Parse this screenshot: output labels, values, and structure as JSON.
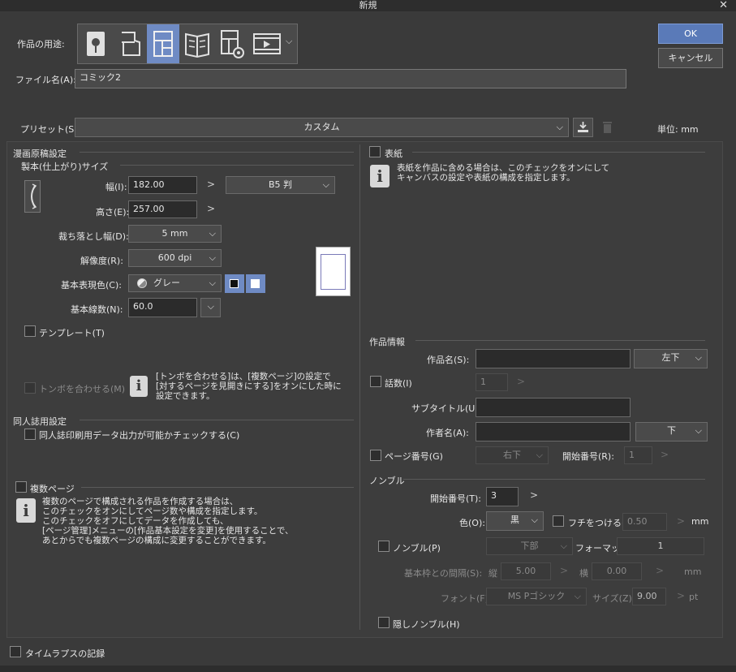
{
  "window": {
    "title": "新規",
    "close": "✕"
  },
  "purpose": {
    "label": "作品の用途:",
    "icons": [
      "illustration-icon",
      "webtoon-icon",
      "comic-icon",
      "book-icon",
      "page-settings-icon",
      "animation-icon"
    ],
    "active_index": 2
  },
  "actions": {
    "ok": "OK",
    "cancel": "キャンセル"
  },
  "filename": {
    "label": "ファイル名(A):",
    "value": "コミック2"
  },
  "preset": {
    "label": "プリセット(S):",
    "value": "カスタム",
    "unit": "単位: mm"
  },
  "manga": {
    "section": "漫画原稿設定",
    "subsection": "製本(仕上がり)サイズ",
    "width": {
      "label": "幅(I):",
      "value": "182.00",
      "size": "B5 判"
    },
    "height": {
      "label": "高さ(E):",
      "value": "257.00"
    },
    "bleed": {
      "label": "裁ち落とし幅(D):",
      "value": "5 mm"
    },
    "resolution": {
      "label": "解像度(R):",
      "value": "600 dpi"
    },
    "color": {
      "label": "基本表現色(C):",
      "value": "グレー"
    },
    "lines": {
      "label": "基本線数(N):",
      "value": "60.0"
    },
    "template": "テンプレート(T)",
    "tombo": "トンボを合わせる(M)",
    "tombo_note": [
      "[トンボを合わせる]は、[複数ページ]の設定で",
      "[対するページを見開きにする]をオンにした時に",
      "設定できます。"
    ]
  },
  "doujin": {
    "section": "同人誌用設定",
    "check": "同人誌印刷用データ出力が可能かチェックする(C)"
  },
  "multi": {
    "check": "複数ページ",
    "note": [
      "複数のページで構成される作品を作成する場合は、",
      "このチェックをオンにしてページ数や構成を指定します。",
      "このチェックをオフにしてデータを作成しても、",
      "[ページ管理]メニューの[作品基本設定を変更]を使用することで、",
      "あとからでも複数ページの構成に変更することができます。"
    ]
  },
  "cover": {
    "check": "表紙",
    "note": [
      "表紙を作品に含める場合は、このチェックをオンにして",
      "キャンバスの設定や表紙の構成を指定します。"
    ]
  },
  "info": {
    "section": "作品情報",
    "title": {
      "label": "作品名(S):",
      "value": "",
      "pos": "左下"
    },
    "episode": {
      "label": "話数(I)",
      "value": "1"
    },
    "subtitle": {
      "label": "サブタイトル(U):",
      "value": ""
    },
    "author": {
      "label": "作者名(A):",
      "value": "",
      "pos": "下"
    },
    "page_no": {
      "label": "ページ番号(G)",
      "pos": "右下",
      "start_label": "開始番号(R):",
      "start_value": "1"
    }
  },
  "nombre": {
    "section": "ノンブル",
    "start": {
      "label": "開始番号(T):",
      "value": "3"
    },
    "color": {
      "label": "色(O):",
      "value": "黒"
    },
    "border": {
      "label": "フチをつける(E)",
      "value": "0.50",
      "unit": "mm"
    },
    "nombre": {
      "label": "ノンブル(P)",
      "pos": "下部",
      "format_label": "フォーマット",
      "format_value": "1"
    },
    "margin": {
      "label": "基本枠との間隔(S):",
      "v_label": "縦",
      "v_value": "5.00",
      "h_label": "横",
      "h_value": "0.00",
      "unit": "mm"
    },
    "font": {
      "label": "フォント(F):",
      "value": "MS Pゴシック",
      "size_label": "サイズ(Z):",
      "size_value": "9.00",
      "unit": "pt"
    },
    "hidden": "隠しノンブル(H)"
  },
  "timelapse": "タイムラプスの記録",
  "colors": {
    "accent": "#6f8bc4",
    "bg": "#3a3a3a"
  }
}
